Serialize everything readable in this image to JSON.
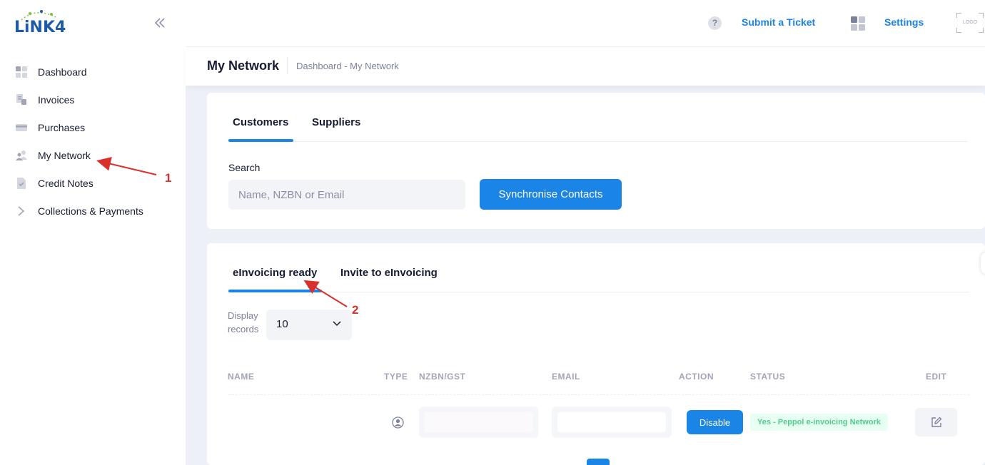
{
  "app": {
    "logo_text": "LiNK4"
  },
  "sidebar": {
    "items": [
      {
        "label": "Dashboard",
        "icon": "dashboard-icon"
      },
      {
        "label": "Invoices",
        "icon": "invoices-icon"
      },
      {
        "label": "Purchases",
        "icon": "credit-card-icon"
      },
      {
        "label": "My Network",
        "icon": "network-users-icon"
      },
      {
        "label": "Credit Notes",
        "icon": "document-check-icon"
      },
      {
        "label": "Collections & Payments",
        "icon": "arrow-right-icon"
      }
    ]
  },
  "header": {
    "help_glyph": "?",
    "submit_ticket": "Submit a Ticket",
    "settings": "Settings",
    "logo_placeholder": "LOGO"
  },
  "subheader": {
    "title": "My Network",
    "breadcrumb": "Dashboard - My Network"
  },
  "contacts_card": {
    "tabs": [
      "Customers",
      "Suppliers"
    ],
    "active_tab": "Customers",
    "search_label": "Search",
    "search_placeholder": "Name, NZBN or Email",
    "sync_button": "Synchronise Contacts"
  },
  "einvoicing_card": {
    "tabs": [
      "eInvoicing ready",
      "Invite to eInvoicing"
    ],
    "active_tab": "eInvoicing ready",
    "display_label_line1": "Display",
    "display_label_line2": "records",
    "display_value": "10",
    "columns": [
      "NAME",
      "TYPE",
      "NZBN/GST",
      "EMAIL",
      "ACTION",
      "STATUS",
      "EDIT"
    ],
    "rows": [
      {
        "name": "",
        "type_icon": "user-circle-icon",
        "nzbn": "",
        "email": "",
        "action": "Disable",
        "status": "Yes - Peppol e-invoicing Network"
      }
    ]
  },
  "annotations": {
    "marker_1": "1",
    "marker_2": "2",
    "color": "#d9302c"
  },
  "colors": {
    "primary": "#1b84e7",
    "success_text": "#50cd89",
    "success_bg": "#e8fff3"
  }
}
